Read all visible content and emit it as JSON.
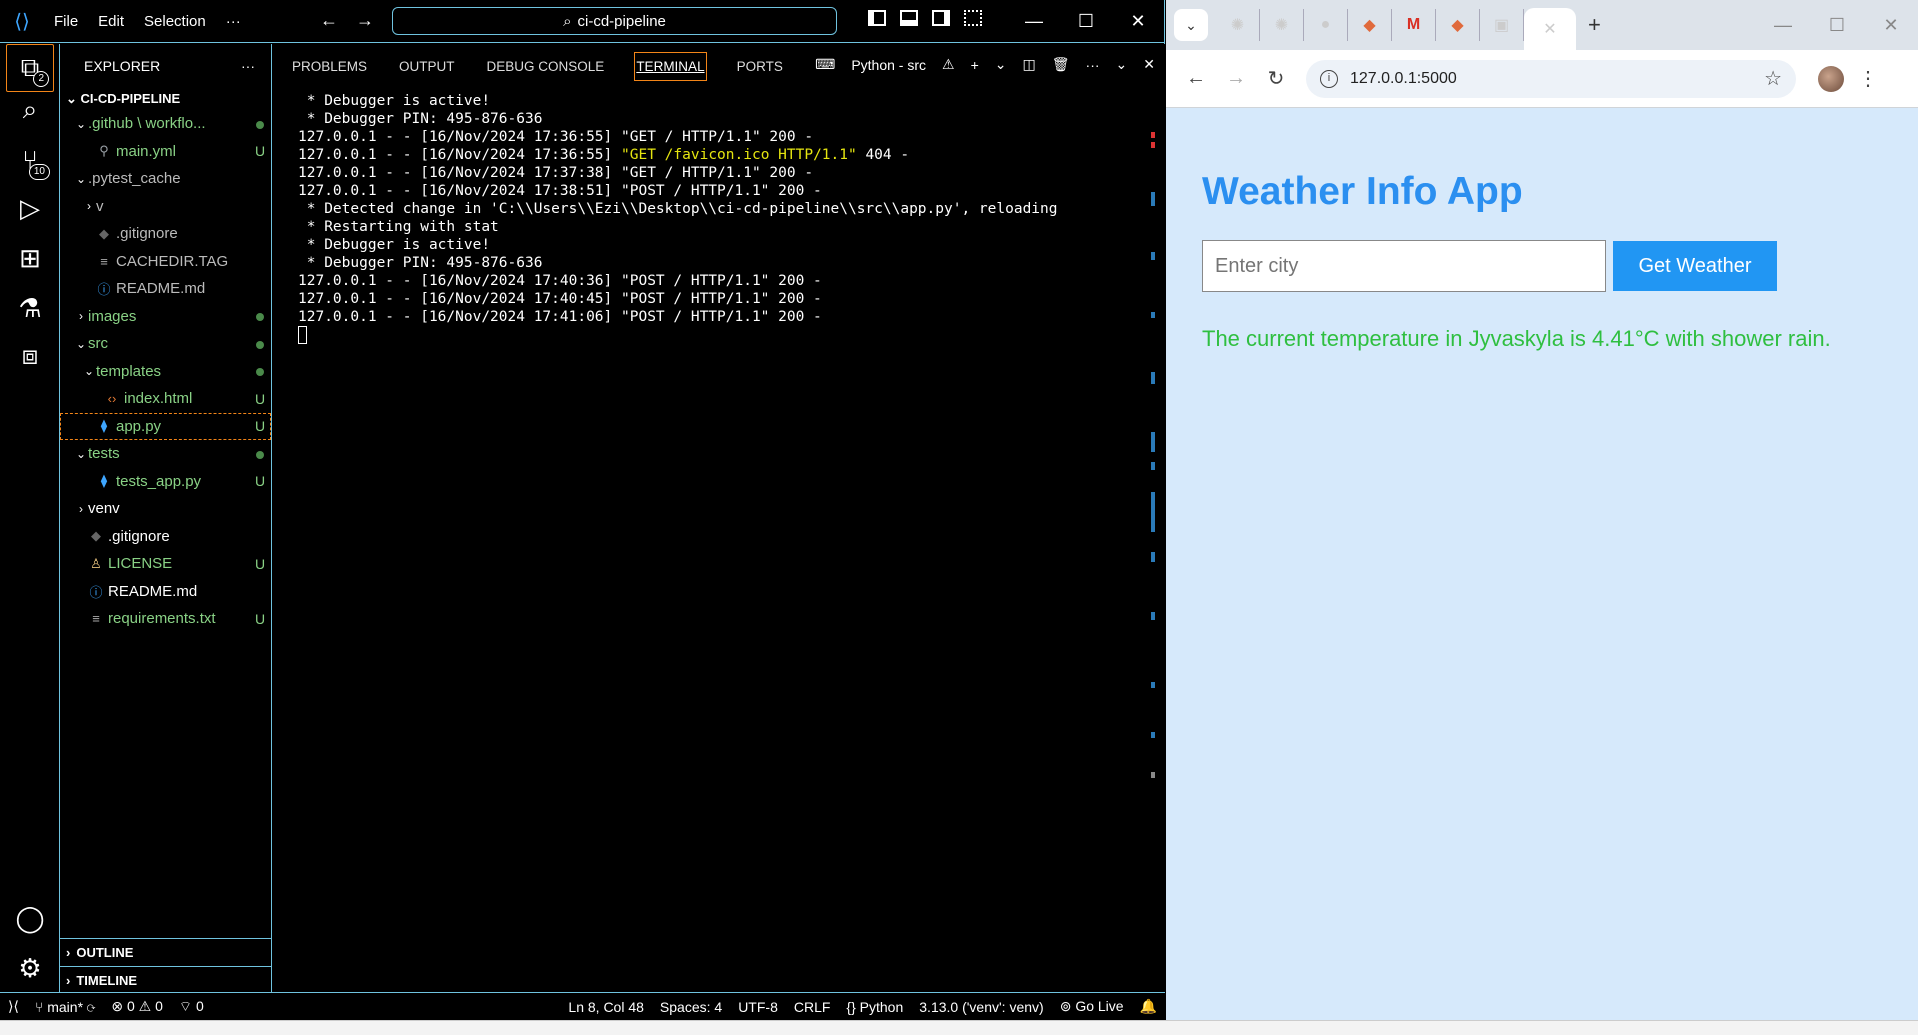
{
  "vscode": {
    "menu": [
      "File",
      "Edit",
      "Selection",
      "···"
    ],
    "search_text": "ci-cd-pipeline",
    "activity": {
      "explorer_badge": "2",
      "scm_badge": "10"
    },
    "explorer": {
      "title": "EXPLORER",
      "more": "···",
      "root": "CI-CD-PIPELINE",
      "tree": [
        {
          "label": ".github \\ workflo...",
          "indent": 1,
          "chev": "down",
          "icon": "",
          "color": "green",
          "deco": "dot"
        },
        {
          "label": "main.yml",
          "indent": 2,
          "chev": "",
          "icon": "yml",
          "color": "green",
          "deco": "U"
        },
        {
          "label": ".pytest_cache",
          "indent": 1,
          "chev": "down",
          "icon": "",
          "color": "grey",
          "deco": ""
        },
        {
          "label": "v",
          "indent": 2,
          "chev": "right",
          "icon": "",
          "color": "grey",
          "deco": ""
        },
        {
          "label": ".gitignore",
          "indent": 2,
          "chev": "",
          "icon": "git",
          "color": "grey",
          "deco": ""
        },
        {
          "label": "CACHEDIR.TAG",
          "indent": 2,
          "chev": "",
          "icon": "lines",
          "color": "grey",
          "deco": ""
        },
        {
          "label": "README.md",
          "indent": 2,
          "chev": "",
          "icon": "info",
          "color": "grey",
          "deco": ""
        },
        {
          "label": "images",
          "indent": 1,
          "chev": "right",
          "icon": "",
          "color": "green",
          "deco": "dot"
        },
        {
          "label": "src",
          "indent": 1,
          "chev": "down",
          "icon": "",
          "color": "green",
          "deco": "dot"
        },
        {
          "label": "templates",
          "indent": 2,
          "chev": "down",
          "icon": "",
          "color": "green",
          "deco": "dot"
        },
        {
          "label": "index.html",
          "indent": 3,
          "chev": "",
          "icon": "html",
          "color": "green",
          "deco": "U"
        },
        {
          "label": "app.py",
          "indent": 2,
          "chev": "",
          "icon": "py",
          "color": "green",
          "deco": "U",
          "selected": true
        },
        {
          "label": "tests",
          "indent": 1,
          "chev": "down",
          "icon": "",
          "color": "green",
          "deco": "dot"
        },
        {
          "label": "tests_app.py",
          "indent": 2,
          "chev": "",
          "icon": "py",
          "color": "green",
          "deco": "U"
        },
        {
          "label": "venv",
          "indent": 1,
          "chev": "right",
          "icon": "",
          "color": "white",
          "deco": ""
        },
        {
          "label": ".gitignore",
          "indent": 1,
          "chev": "",
          "icon": "git",
          "color": "white",
          "deco": ""
        },
        {
          "label": "LICENSE",
          "indent": 1,
          "chev": "",
          "icon": "license",
          "color": "green",
          "deco": "U"
        },
        {
          "label": "README.md",
          "indent": 1,
          "chev": "",
          "icon": "info",
          "color": "white",
          "deco": ""
        },
        {
          "label": "requirements.txt",
          "indent": 1,
          "chev": "",
          "icon": "lines",
          "color": "green",
          "deco": "U"
        }
      ],
      "outline": "OUTLINE",
      "timeline": "TIMELINE"
    },
    "panel": {
      "tabs": [
        "PROBLEMS",
        "OUTPUT",
        "DEBUG CONSOLE",
        "TERMINAL",
        "PORTS"
      ],
      "active_tab": "TERMINAL",
      "terminal_name": "Python - src",
      "lines": [
        {
          "t": " * Debugger is active!"
        },
        {
          "t": " * Debugger PIN: 495-876-636"
        },
        {
          "t": "127.0.0.1 - - [16/Nov/2024 17:36:55] \"GET / HTTP/1.1\" 200 -"
        },
        {
          "pre": "127.0.0.1 - - [16/Nov/2024 17:36:55] ",
          "hl": "\"GET /favicon.ico HTTP/1.1\"",
          "post": " 404 -"
        },
        {
          "t": "127.0.0.1 - - [16/Nov/2024 17:37:38] \"GET / HTTP/1.1\" 200 -"
        },
        {
          "t": "127.0.0.1 - - [16/Nov/2024 17:38:51] \"POST / HTTP/1.1\" 200 -"
        },
        {
          "t": " * Detected change in 'C:\\\\Users\\\\Ezi\\\\Desktop\\\\ci-cd-pipeline\\\\src\\\\app.py', reloading"
        },
        {
          "t": " * Restarting with stat"
        },
        {
          "t": " * Debugger is active!"
        },
        {
          "t": " * Debugger PIN: 495-876-636"
        },
        {
          "t": "127.0.0.1 - - [16/Nov/2024 17:40:36] \"POST / HTTP/1.1\" 200 -"
        },
        {
          "t": "127.0.0.1 - - [16/Nov/2024 17:40:45] \"POST / HTTP/1.1\" 200 -"
        },
        {
          "t": "127.0.0.1 - - [16/Nov/2024 17:41:06] \"POST / HTTP/1.1\" 200 -"
        }
      ]
    },
    "status": {
      "branch": "main*",
      "errors": "0",
      "warnings": "0",
      "ports": "0",
      "position": "Ln 8, Col 48",
      "spaces": "Spaces: 4",
      "encoding": "UTF-8",
      "eol": "CRLF",
      "language": "Python",
      "interpreter": "3.13.0 ('venv': venv)",
      "golive": "Go Live"
    }
  },
  "chrome": {
    "url": "127.0.0.1:5000",
    "page": {
      "title": "Weather Info App",
      "input_placeholder": "Enter city",
      "button_label": "Get Weather",
      "result": "The current temperature in Jyvaskyla is 4.41°C with shower rain."
    },
    "colors": {
      "page_bg": "#d6e9fb",
      "title": "#2b8ff0",
      "button": "#2196f3",
      "result": "#2fbf40"
    }
  }
}
